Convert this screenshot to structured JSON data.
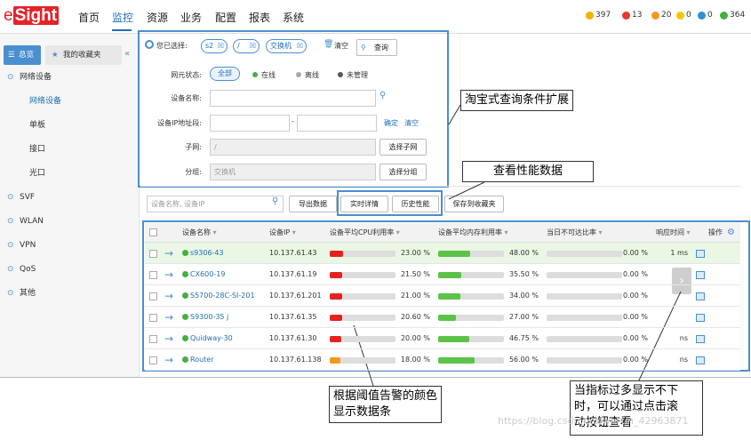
{
  "app": {
    "logo_prefix": "e",
    "logo_brand": "Sight"
  },
  "nav": [
    "首页",
    "监控",
    "资源",
    "业务",
    "配置",
    "报表",
    "系统"
  ],
  "alarms": [
    {
      "count": "397",
      "color": "#f0b400"
    },
    {
      "count": "13",
      "color": "#e5392b"
    },
    {
      "count": "20",
      "color": "#f39a1b"
    },
    {
      "count": "0",
      "color": "#f7c600"
    },
    {
      "count": "0",
      "color": "#2f8fd8"
    },
    {
      "count": "364",
      "color": "#45b040"
    }
  ],
  "sidebar": {
    "tab_overview": "总览",
    "tab_fav": "我的收藏夹",
    "items": [
      {
        "label": "网络设备",
        "type": "group"
      },
      {
        "label": "网络设备",
        "type": "sub",
        "selected": true
      },
      {
        "label": "单板",
        "type": "sub"
      },
      {
        "label": "接口",
        "type": "sub"
      },
      {
        "label": "光口",
        "type": "sub"
      },
      {
        "label": "SVF",
        "type": "group"
      },
      {
        "label": "WLAN",
        "type": "group"
      },
      {
        "label": "VPN",
        "type": "group"
      },
      {
        "label": "QoS",
        "type": "group"
      },
      {
        "label": "其他",
        "type": "group"
      }
    ]
  },
  "filter": {
    "selected_label": "您已选择:",
    "chips": [
      "s2",
      "/",
      "交换机"
    ],
    "clear": "清空",
    "query": "查询",
    "status_label": "网元状态:",
    "status_options": [
      "全部",
      "在线",
      "离线",
      "未管理"
    ],
    "name_label": "设备名称:",
    "ip_label": "设备IP地址段:",
    "ip_sep": "-",
    "ip_confirm": "确定",
    "ip_clear": "清空",
    "subnet_label": "子网:",
    "subnet_value": "/",
    "subnet_btn": "选择子网",
    "group_label": "分组:",
    "group_value": "交换机",
    "group_btn": "选择分组"
  },
  "toolbar": {
    "search_placeholder": "设备名称, 设备IP",
    "export": "导出数据",
    "realtime": "实时详情",
    "history": "历史性能",
    "save_fav": "保存到收藏夹"
  },
  "table": {
    "headers": [
      "设备名称",
      "设备IP",
      "设备平均CPU利用率",
      "设备平均内存利用率",
      "当日不可达比率",
      "响应时间",
      "操作"
    ],
    "rows": [
      {
        "name": "s9306-43",
        "ip": "10.137.61.43",
        "cpu": "23.00 %",
        "cpu_v": 23,
        "cpu_color": "#e5221f",
        "mem": "48.00 %",
        "mem_v": 48,
        "unr": "0.00 %",
        "unr_v": 0,
        "resp": "1 ms",
        "highlight": true
      },
      {
        "name": "CX600-19",
        "ip": "10.137.61.19",
        "cpu": "21.50 %",
        "cpu_v": 21.5,
        "cpu_color": "#e5221f",
        "mem": "35.50 %",
        "mem_v": 35.5,
        "unr": "0.00 %",
        "unr_v": 0,
        "resp": "",
        "highlight": false
      },
      {
        "name": "S5700-28C-SI-201",
        "ip": "10.137.61.201",
        "cpu": "21.00 %",
        "cpu_v": 21,
        "cpu_color": "#e5221f",
        "mem": "34.00 %",
        "mem_v": 34,
        "unr": "0.00 %",
        "unr_v": 0,
        "resp": "",
        "highlight": false
      },
      {
        "name": "S9300-35 j",
        "ip": "10.137.61.35",
        "cpu": "20.60 %",
        "cpu_v": 20.6,
        "cpu_color": "#e5221f",
        "mem": "27.00 %",
        "mem_v": 27,
        "unr": "0.00 %",
        "unr_v": 0,
        "resp": "",
        "highlight": false
      },
      {
        "name": "Quidway-30",
        "ip": "10.137.61.30",
        "cpu": "20.00 %",
        "cpu_v": 20,
        "cpu_color": "#e5221f",
        "mem": "46.75 %",
        "mem_v": 46.75,
        "unr": "0.00 %",
        "unr_v": 0,
        "resp": "ns",
        "highlight": false
      },
      {
        "name": "Router",
        "ip": "10.137.61.138",
        "cpu": "18.00 %",
        "cpu_v": 18,
        "cpu_color": "#f39a1b",
        "mem": "56.00 %",
        "mem_v": 56,
        "unr": "0.00 %",
        "unr_v": 0,
        "resp": "ns",
        "highlight": false
      }
    ]
  },
  "callouts": {
    "filter": "淘宝式查询条件扩展",
    "perf": "查看性能数据",
    "color": "根据阈值告警的颜色\n显示数据条",
    "scroll": "当指标过多显示不下\n时，可以通过点击滚\n动按钮查看"
  },
  "watermark": "https://blog.csdn.net/weixin_42963871"
}
